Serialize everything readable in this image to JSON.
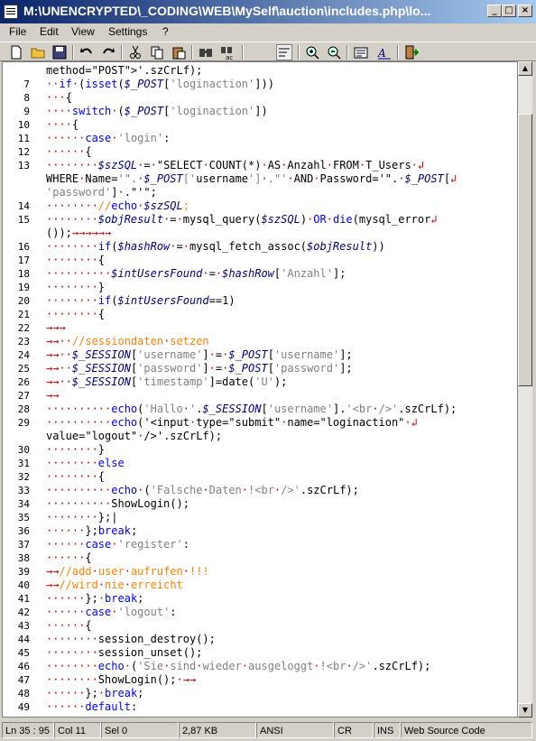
{
  "window": {
    "title": "M:\\UNENCRYPTED\\_CODING\\WEB\\MySelf\\auction\\includes.php\\lo...",
    "buttons": [
      "minimize",
      "maximize",
      "close"
    ]
  },
  "menu": [
    "File",
    "Edit",
    "View",
    "Settings",
    "?"
  ],
  "toolbar": [
    "new",
    "open",
    "save",
    "undo",
    "redo",
    "cut",
    "copy",
    "paste",
    "find",
    "replace",
    "word-wrap",
    "zoom-in",
    "zoom-out",
    "options",
    "font",
    "exit"
  ],
  "editor": {
    "lines": [
      {
        "n": "",
        "c": "method=\"POST\">'.szCrLf);"
      },
      {
        "n": "7",
        "c": "··if·(isset($_POST['loginaction']))"
      },
      {
        "n": "8",
        "c": "···{"
      },
      {
        "n": "9",
        "c": "····switch·($_POST['loginaction'])"
      },
      {
        "n": "10",
        "c": "····{"
      },
      {
        "n": "11",
        "c": "······case·'login':"
      },
      {
        "n": "12",
        "c": "······{"
      },
      {
        "n": "13",
        "c": "········$szSQL·=·\"SELECT·COUNT(*)·AS·Anzahl·FROM·T_Users·↲"
      },
      {
        "n": "",
        "c": "WHERE·Name='\".·$_POST['username']·.\"'·AND·Password='\".·$_POST[↲"
      },
      {
        "n": "",
        "c": "'password']·.\"'\";"
      },
      {
        "n": "14",
        "c": "········//echo·$szSQL;"
      },
      {
        "n": "15",
        "c": "········$objResult·=·mysql_query($szSQL)·OR·die(mysql_error↲"
      },
      {
        "n": "",
        "c": "());→→→→→→"
      },
      {
        "n": "16",
        "c": "········if($hashRow·=·mysql_fetch_assoc($objResult))"
      },
      {
        "n": "17",
        "c": "········{"
      },
      {
        "n": "18",
        "c": "··········$intUsersFound·=·$hashRow['Anzahl'];"
      },
      {
        "n": "19",
        "c": "········}"
      },
      {
        "n": "20",
        "c": "········if($intUsersFound==1)"
      },
      {
        "n": "21",
        "c": "········{"
      },
      {
        "n": "22",
        "c": "→→→"
      },
      {
        "n": "23",
        "c": "→→··//sessiondaten·setzen"
      },
      {
        "n": "24",
        "c": "→→··$_SESSION['username']·=·$_POST['username'];"
      },
      {
        "n": "25",
        "c": "→→··$_SESSION['password']·=·$_POST['password'];"
      },
      {
        "n": "26",
        "c": "→→··$_SESSION['timestamp']=date('U');"
      },
      {
        "n": "27",
        "c": "→→"
      },
      {
        "n": "28",
        "c": "··········echo('Hallo·'.$_SESSION['username'].'<br·/>'.szCrLf);"
      },
      {
        "n": "29",
        "c": "··········echo('<input·type=\"submit\"·name=\"loginaction\"·↲"
      },
      {
        "n": "",
        "c": "value=\"logout\"·/>'.szCrLf);"
      },
      {
        "n": "30",
        "c": "········}"
      },
      {
        "n": "31",
        "c": "········else"
      },
      {
        "n": "32",
        "c": "········{"
      },
      {
        "n": "33",
        "c": "··········echo·('Falsche·Daten·!<br·/>'.szCrLf);"
      },
      {
        "n": "34",
        "c": "··········ShowLogin();"
      },
      {
        "n": "35",
        "c": "········};|"
      },
      {
        "n": "36",
        "c": "······};break;"
      },
      {
        "n": "37",
        "c": "······case·'register':"
      },
      {
        "n": "38",
        "c": "······{"
      },
      {
        "n": "39",
        "c": "→→//add·user·aufrufen·!!!"
      },
      {
        "n": "40",
        "c": "→→//wird·nie·erreicht"
      },
      {
        "n": "41",
        "c": "······};·break;"
      },
      {
        "n": "42",
        "c": "······case·'logout':"
      },
      {
        "n": "43",
        "c": "······{"
      },
      {
        "n": "44",
        "c": "········session_destroy();"
      },
      {
        "n": "45",
        "c": "········session_unset();"
      },
      {
        "n": "46",
        "c": "········echo·('Sie·sind·wieder·ausgeloggt·!<br·/>'.szCrLf);"
      },
      {
        "n": "47",
        "c": "········ShowLogin();·→→"
      },
      {
        "n": "48",
        "c": "······};·break;"
      },
      {
        "n": "49",
        "c": "······default:"
      }
    ]
  },
  "status": {
    "position": "Ln 35 : 95",
    "col": "Col 11",
    "sel": "Sel 0",
    "size": "2,87 KB",
    "encoding": "ANSI",
    "eol": "CR",
    "ins": "INS",
    "scheme": "Web Source Code"
  }
}
